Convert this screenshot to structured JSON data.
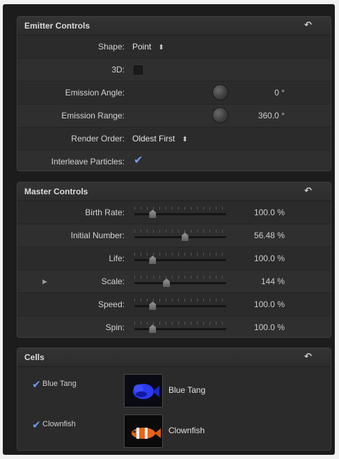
{
  "emitter": {
    "title": "Emitter Controls",
    "shape_label": "Shape:",
    "shape_value": "Point",
    "threed_label": "3D:",
    "angle_label": "Emission Angle:",
    "angle_value": "0 °",
    "range_label": "Emission Range:",
    "range_value": "360.0 °",
    "order_label": "Render Order:",
    "order_value": "Oldest First",
    "interleave_label": "Interleave Particles:"
  },
  "master": {
    "title": "Master Controls",
    "rows": [
      {
        "label": "Birth Rate:",
        "value": "100.0 %",
        "level": 0.2
      },
      {
        "label": "Initial Number:",
        "value": "56.48 %",
        "level": 0.55
      },
      {
        "label": "Life:",
        "value": "100.0 %",
        "level": 0.2
      },
      {
        "label": "Scale:",
        "value": "144 %",
        "level": 0.35
      },
      {
        "label": "Speed:",
        "value": "100.0 %",
        "level": 0.2
      },
      {
        "label": "Spin:",
        "value": "100.0 %",
        "level": 0.2
      }
    ]
  },
  "cells": {
    "title": "Cells",
    "items": [
      {
        "name": "Blue Tang",
        "checked": true,
        "title": "Blue Tang"
      },
      {
        "name": "Clownfish",
        "checked": true,
        "title": "Clownfish"
      }
    ]
  },
  "icons": {
    "reset": "reset-arrow-icon",
    "updown": "up-down-arrows-icon",
    "check": "checkmark-icon",
    "disclosure": "disclosure-triangle-icon"
  },
  "colors": {
    "accent": "#6f9fe8",
    "panel": "#2b2b2b"
  }
}
